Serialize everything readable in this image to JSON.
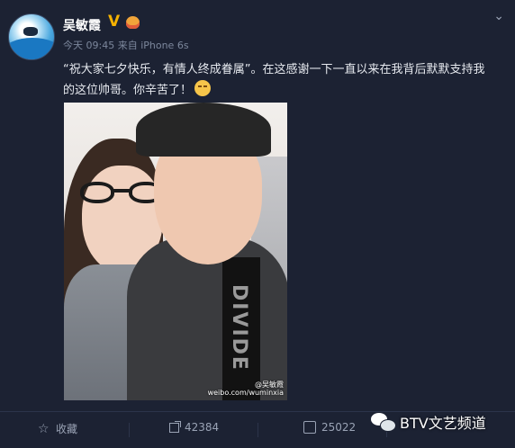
{
  "post": {
    "author": "吴敏霞",
    "verified_badge": "V",
    "meta": "今天 09:45 来自 iPhone 6s",
    "text_line1": "“祝大家七夕快乐，有情人终成眷属”。在这感谢一下一直以来在我背后默默支持我",
    "text_line2": "的这位帅哥。你辛苦了！",
    "photo_shirt_text": "DIVIDE",
    "watermark_line1": "@吴敏霞",
    "watermark_line2": "weibo.com/wuminxia"
  },
  "actions": {
    "favorite": "收藏",
    "repost_count": "42384",
    "comment_count": "25022",
    "like_count": ""
  },
  "brand": {
    "label": "BTV文艺频道"
  },
  "icons": [
    "avatar",
    "vip-crown-icon",
    "chevron-down-icon",
    "star-icon",
    "share-icon",
    "comment-icon",
    "like-icon",
    "wechat-icon",
    "emoji-icon"
  ],
  "colors": {
    "background": "#1c2233",
    "text": "#e6e9ef",
    "meta": "#7c879c",
    "verified": "#f5b200"
  }
}
